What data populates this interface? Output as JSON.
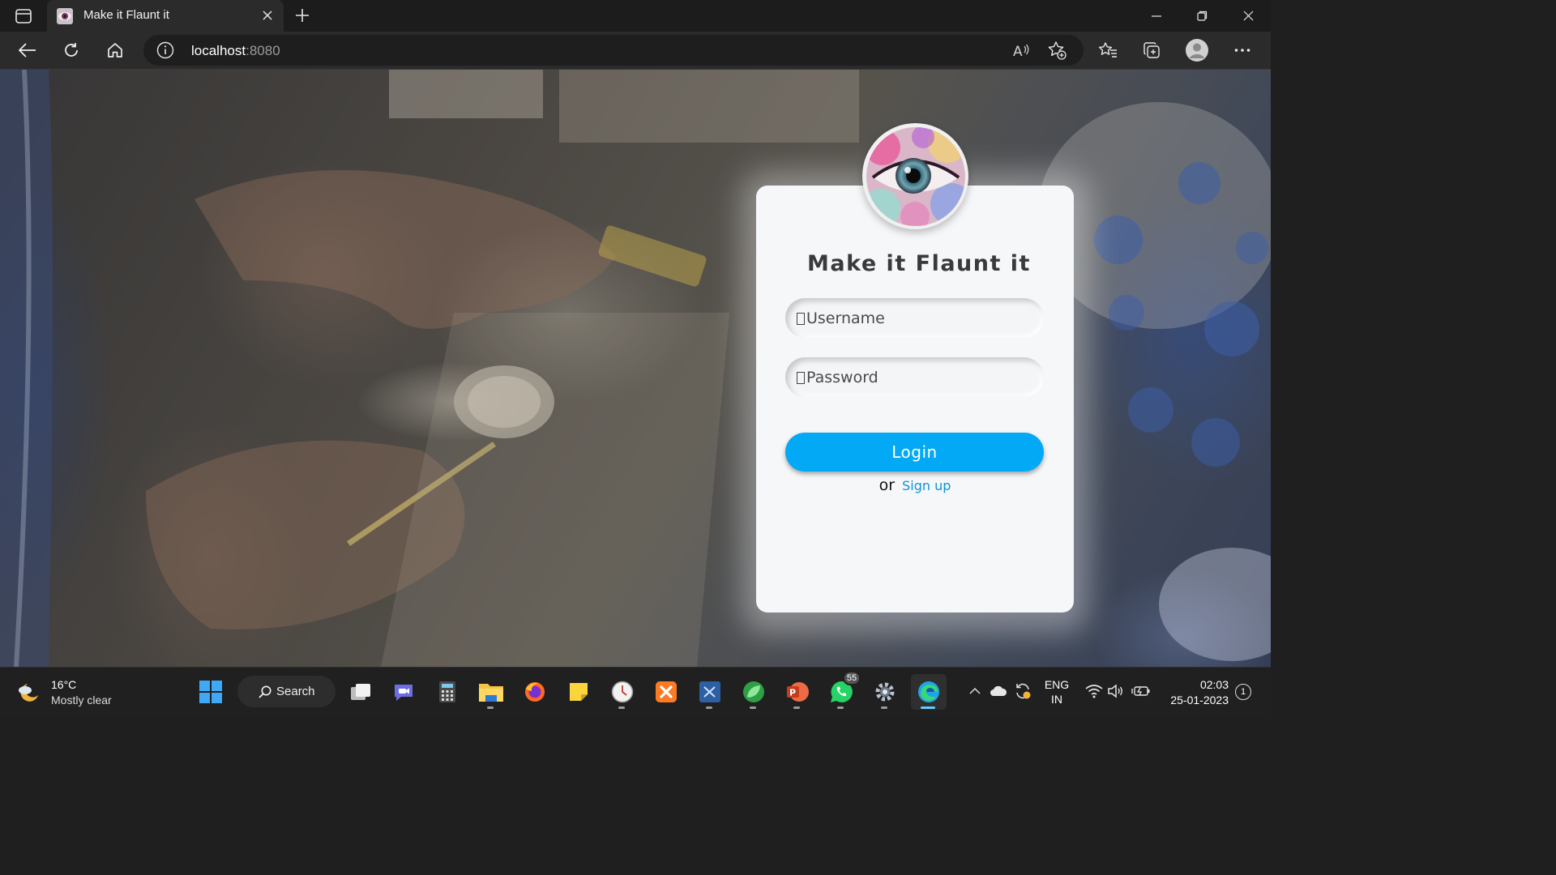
{
  "browser": {
    "tab_title": "Make it Flaunt it",
    "url_host": "localhost",
    "url_port": ":8080"
  },
  "login": {
    "title": "Make it Flaunt it",
    "username_placeholder": "Username",
    "password_placeholder": "Password",
    "login_button": "Login",
    "or_text": "or",
    "signup_link": "Sign up"
  },
  "taskbar": {
    "weather_temp": "16°C",
    "weather_desc": "Mostly clear",
    "search_label": "Search",
    "whatsapp_badge": "55",
    "language_line1": "ENG",
    "language_line2": "IN",
    "time": "02:03",
    "date": "25-01-2023",
    "notification_count": "1",
    "apps": [
      "task-view",
      "teams-chat",
      "calculator",
      "file-explorer",
      "firefox",
      "sticky-notes",
      "clock-app",
      "xampp",
      "vscode",
      "green-leaf-app",
      "powerpoint",
      "whatsapp",
      "settings",
      "edge"
    ]
  },
  "colors": {
    "accent": "#03a9f4",
    "link": "#0a95e0",
    "title_text": "#3a3a3a",
    "card_bg": "#f6f7f9"
  }
}
